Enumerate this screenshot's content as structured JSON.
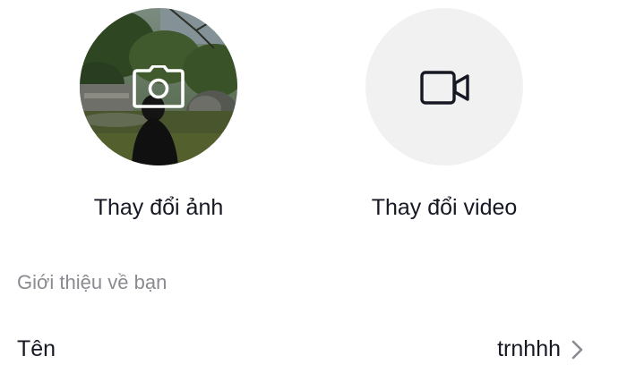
{
  "avatar": {
    "caption": "Thay đổi ảnh",
    "icon": "camera-icon"
  },
  "video": {
    "caption": "Thay đổi video",
    "icon": "video-camera-icon"
  },
  "section": {
    "label": "Giới thiệu về bạn"
  },
  "name_row": {
    "label": "Tên",
    "value": "trnhhh",
    "icon": "chevron-right-icon"
  },
  "colors": {
    "text_primary": "#161823",
    "text_secondary": "#8a8b91",
    "placeholder_bg": "#f1f1f2"
  }
}
